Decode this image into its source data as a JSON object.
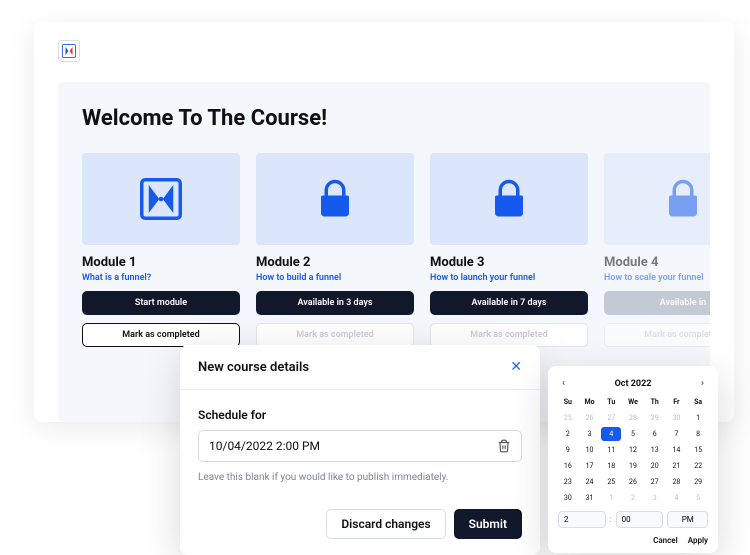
{
  "page": {
    "title": "Welcome To The Course!"
  },
  "colors": {
    "accent": "#1559ed",
    "dark": "#12182b"
  },
  "modules": [
    {
      "title": "Module 1",
      "subtitle": "What is a funnel?",
      "primary_label": "Start module",
      "secondary_label": "Mark as completed",
      "icon": "funnel-logo",
      "primary_style": "dark",
      "secondary_style": "outline",
      "faded": false
    },
    {
      "title": "Module 2",
      "subtitle": "How to build a funnel",
      "primary_label": "Available in 3 days",
      "secondary_label": "Mark as completed",
      "icon": "lock",
      "primary_style": "dark",
      "secondary_style": "disabled",
      "faded": false
    },
    {
      "title": "Module 3",
      "subtitle": "How to launch your funnel",
      "primary_label": "Available in 7 days",
      "secondary_label": "Mark as completed",
      "icon": "lock",
      "primary_style": "dark",
      "secondary_style": "disabled",
      "faded": false
    },
    {
      "title": "Module 4",
      "subtitle": "How to scale your funnel",
      "primary_label": "Available in",
      "secondary_label": "Mark as completed",
      "icon": "lock",
      "primary_style": "grey",
      "secondary_style": "disabled",
      "faded": true
    }
  ],
  "modal": {
    "title": "New course details",
    "field_label": "Schedule for",
    "value": "10/04/2022 2:00 PM",
    "helper": "Leave this blank if you would like to publish immediately.",
    "discard_label": "Discard changes",
    "submit_label": "Submit"
  },
  "calendar": {
    "month_label": "Oct 2022",
    "dow": [
      "Su",
      "Mo",
      "Tu",
      "We",
      "Th",
      "Fr",
      "Sa"
    ],
    "days": [
      {
        "n": 25,
        "other": true
      },
      {
        "n": 26,
        "other": true
      },
      {
        "n": 27,
        "other": true
      },
      {
        "n": 28,
        "other": true
      },
      {
        "n": 29,
        "other": true
      },
      {
        "n": 30,
        "other": true
      },
      {
        "n": 1
      },
      {
        "n": 2
      },
      {
        "n": 3
      },
      {
        "n": 4,
        "selected": true
      },
      {
        "n": 5
      },
      {
        "n": 6
      },
      {
        "n": 7
      },
      {
        "n": 8
      },
      {
        "n": 9
      },
      {
        "n": 10
      },
      {
        "n": 11
      },
      {
        "n": 12
      },
      {
        "n": 13
      },
      {
        "n": 14
      },
      {
        "n": 15
      },
      {
        "n": 16
      },
      {
        "n": 17
      },
      {
        "n": 18
      },
      {
        "n": 19
      },
      {
        "n": 20
      },
      {
        "n": 21
      },
      {
        "n": 22
      },
      {
        "n": 23
      },
      {
        "n": 24
      },
      {
        "n": 25
      },
      {
        "n": 26
      },
      {
        "n": 27
      },
      {
        "n": 28
      },
      {
        "n": 29
      },
      {
        "n": 30
      },
      {
        "n": 31
      },
      {
        "n": 1,
        "other": true
      },
      {
        "n": 2,
        "other": true
      },
      {
        "n": 3,
        "other": true
      },
      {
        "n": 4,
        "other": true
      },
      {
        "n": 5,
        "other": true
      }
    ],
    "time": {
      "hour": "2",
      "minute": "00",
      "meridiem": "PM"
    },
    "cancel_label": "Cancel",
    "apply_label": "Apply"
  }
}
